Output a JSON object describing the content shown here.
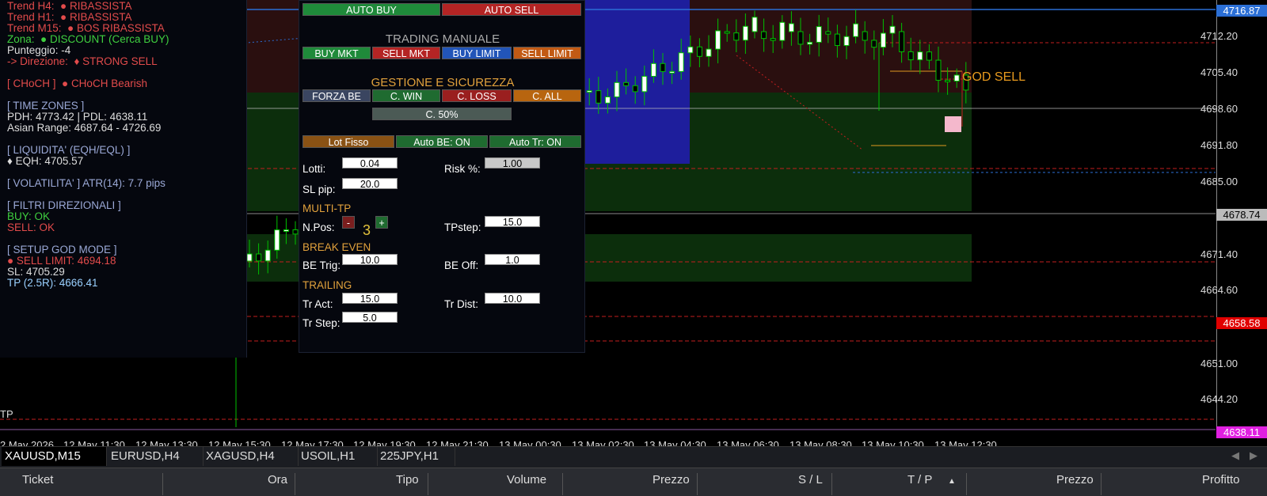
{
  "info_panel": {
    "trend_h4_label": "Trend H4:",
    "trend_h4_value": "RIBASSISTA",
    "trend_h1_label": "Trend H1:",
    "trend_h1_value": "RIBASSISTA",
    "trend_m15_label": "Trend M15:",
    "trend_m15_value": "BOS RIBASSISTA",
    "zona_label": "Zona:",
    "zona_value": "DISCOUNT (Cerca BUY)",
    "punteggio": "Punteggio: -4",
    "direzione_label": "-> Direzione:",
    "direzione_value": "STRONG SELL",
    "choch_label": "[ CHoCH ]",
    "choch_value": "CHoCH Bearish",
    "time_zones": "[ TIME ZONES ]",
    "pdh_pdl": "PDH: 4773.42 | PDL: 4638.11",
    "asian_range": "Asian Range: 4687.64 - 4726.69",
    "liquidita": "[ LIQUIDITA' (EQH/EQL) ]",
    "eqh": "EQH: 4705.57",
    "volatilita": "[ VOLATILITA' ] ATR(14): 7.7 pips",
    "filtri": "[ FILTRI DIREZIONALI ]",
    "buy_ok": "BUY: OK",
    "sell_ok": "SELL: OK",
    "setup": "[ SETUP GOD MODE ]",
    "sell_limit": "SELL LIMIT: 4694.18",
    "sl": "SL: 4705.29",
    "tp": "TP (2.5R): 4666.41"
  },
  "trade_panel": {
    "auto_buy": "AUTO BUY",
    "auto_sell": "AUTO SELL",
    "trading_title": "TRADING MANUALE",
    "buy_mkt": "BUY MKT",
    "sell_mkt": "SELL MKT",
    "buy_limit": "BUY LIMIT",
    "sell_limit": "SELL LIMIT",
    "gestione_title": "GESTIONE E SICUREZZA",
    "forza_be": "FORZA BE",
    "c_win": "C. WIN",
    "c_loss": "C. LOSS",
    "c_all": "C. ALL",
    "c_50": "C. 50%",
    "lot_fisso": "Lot Fisso",
    "auto_be": "Auto BE: ON",
    "auto_tr": "Auto Tr: ON",
    "lotti_label": "Lotti:",
    "lotti_value": "0.04",
    "risk_label": "Risk %:",
    "risk_value": "1.00",
    "sl_pip_label": "SL pip:",
    "sl_pip_value": "20.0",
    "multi_tp": "MULTI-TP",
    "npos_label": "N.Pos:",
    "npos_minus": "-",
    "npos_value": "3",
    "npos_plus": "+",
    "tpstep_label": "TPstep:",
    "tpstep_value": "15.0",
    "break_even": "BREAK EVEN",
    "be_trig_label": "BE Trig:",
    "be_trig_value": "10.0",
    "be_off_label": "BE Off:",
    "be_off_value": "1.0",
    "trailing": "TRAILING",
    "tr_act_label": "Tr Act:",
    "tr_act_value": "15.0",
    "tr_dist_label": "Tr Dist:",
    "tr_dist_value": "10.0",
    "tr_step_label": "Tr Step:",
    "tr_step_value": "5.0"
  },
  "chart": {
    "god_sell": "GOD SELL",
    "tp_label": "TP",
    "price_ticks": [
      "4712.20",
      "4705.40",
      "4698.60",
      "4691.80",
      "4685.00",
      "4671.40",
      "4664.60",
      "4651.00",
      "4644.20"
    ],
    "price_badges": {
      "top": "4716.87",
      "current": "4678.74",
      "red": "4658.58",
      "magenta": "4638.11"
    },
    "time_ticks": [
      "2 May 2026",
      "12 May 11:30",
      "12 May 13:30",
      "12 May 15:30",
      "12 May 17:30",
      "12 May 19:30",
      "12 May 21:30",
      "13 May 00:30",
      "13 May 02:30",
      "13 May 04:30",
      "13 May 06:30",
      "13 May 08:30",
      "13 May 10:30",
      "13 May 12:30"
    ],
    "colors": {
      "bull_candle": "#ffffff",
      "wick": "#00c000",
      "up_zone": "#0c2e0c",
      "premium_zone": "#2a0f0f",
      "asian_box": "#1e1e9c",
      "level_line": "#c21e1e",
      "blue_line": "#2b6fd6"
    }
  },
  "tabs": [
    "XAUUSD,M15",
    "EURUSD,H4",
    "XAGUSD,H4",
    "USOIL,H1",
    "225JPY,H1"
  ],
  "columns": [
    "Ticket",
    "Ora",
    "Tipo",
    "Volume",
    "Prezzo",
    "S / L",
    "T / P",
    "Prezzo",
    "Profitto"
  ]
}
